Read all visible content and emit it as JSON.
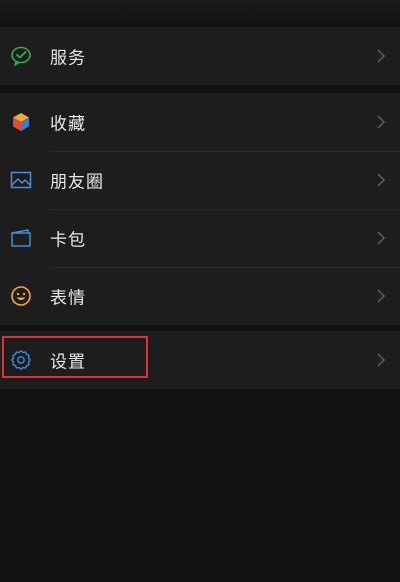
{
  "menu": {
    "services": {
      "label": "服务",
      "icon": "wechat-pay-icon",
      "color": "#2bb24c"
    },
    "favorites": {
      "label": "收藏",
      "icon": "cube-icon",
      "color": "#f2a93b"
    },
    "moments": {
      "label": "朋友圈",
      "icon": "photo-icon",
      "color": "#4a90d9"
    },
    "cards": {
      "label": "卡包",
      "icon": "card-icon",
      "color": "#3a8fe0"
    },
    "stickers": {
      "label": "表情",
      "icon": "smiley-icon",
      "color": "#f2a93b"
    },
    "settings": {
      "label": "设置",
      "icon": "gear-icon",
      "color": "#3a8fe0"
    }
  },
  "highlight": {
    "target": "settings",
    "color": "#e0303a"
  }
}
